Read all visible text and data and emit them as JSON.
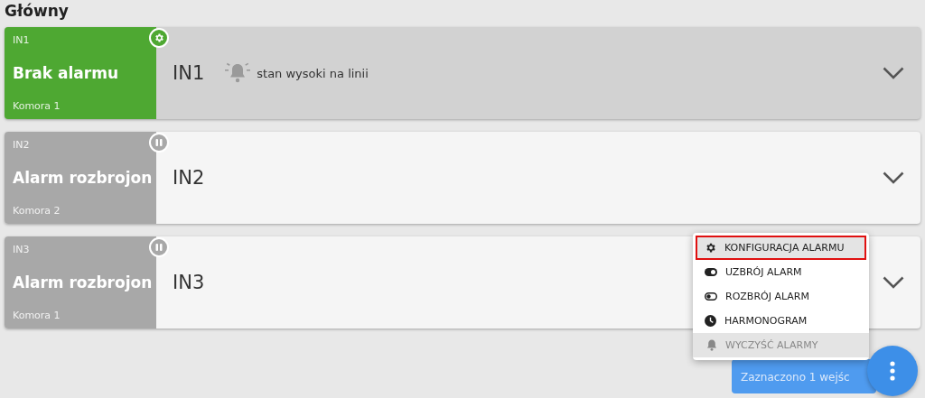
{
  "page": {
    "title": "Główny"
  },
  "inputs": [
    {
      "code": "IN1",
      "status": "Brak alarmu",
      "zone": "Komora 1",
      "name": "IN1",
      "note": "stan wysoki na linii",
      "color": "#4ea832",
      "kind": "gear",
      "selected": true
    },
    {
      "code": "IN2",
      "status": "Alarm rozbrojon",
      "zone": "Komora 2",
      "name": "IN2",
      "color": "#a8a8a8",
      "kind": "pause",
      "selected": false
    },
    {
      "code": "IN3",
      "status": "Alarm rozbrojon",
      "zone": "Komora 1",
      "name": "IN3",
      "color": "#a8a8a8",
      "kind": "pause",
      "selected": false
    }
  ],
  "menu": [
    {
      "kind": "gear",
      "label": "KONFIGURACJA ALARMU",
      "highlighted": true,
      "disabled": false
    },
    {
      "kind": "toggle-on",
      "label": "UZBRÓJ ALARM",
      "highlighted": false,
      "disabled": false
    },
    {
      "kind": "toggle-off",
      "label": "ROZBRÓJ ALARM",
      "highlighted": false,
      "disabled": false
    },
    {
      "kind": "clock",
      "label": "HARMONOGRAM",
      "highlighted": false,
      "disabled": false
    },
    {
      "kind": "bell",
      "label": "WYCZYŚĆ ALARMY",
      "highlighted": false,
      "disabled": true
    }
  ],
  "selection_toast": "Zaznaczono 1 wejśc"
}
